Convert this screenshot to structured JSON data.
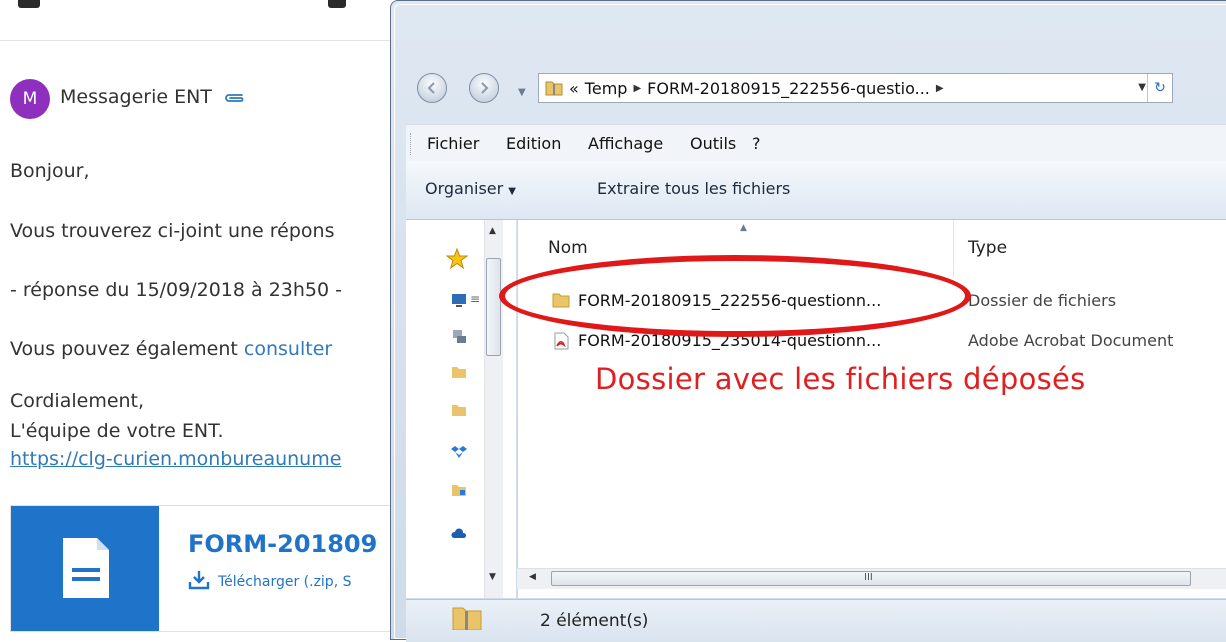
{
  "email": {
    "avatar_letter": "M",
    "sender": "Messagerie ENT",
    "greeting": "Bonjour,",
    "line1": "Vous trouverez ci-joint une répons",
    "line2": "- réponse du 15/09/2018 à 23h50 -",
    "line3_prefix": "Vous pouvez également ",
    "line3_link": "consulter",
    "closing": "Cordialement,",
    "team": "L'équipe de votre ENT.",
    "url": "https://clg-curien.monbureaunume",
    "attachment": {
      "title": "FORM-201809",
      "download": "Télécharger (.zip, S"
    },
    "colors": {
      "avatar": "#8e2fbd",
      "link": "#2f7ab8",
      "card_accent": "#1f73c8"
    }
  },
  "explorer": {
    "address": {
      "history": "«",
      "segments": [
        "Temp",
        "FORM-20180915_222556-questio..."
      ]
    },
    "menu": [
      "Fichier",
      "Edition",
      "Affichage",
      "Outils",
      "?"
    ],
    "toolbar": {
      "organize": "Organiser",
      "extract": "Extraire tous les fichiers"
    },
    "columns": {
      "name": "Nom",
      "type": "Type"
    },
    "files": [
      {
        "name": "FORM-20180915_222556-questionn...",
        "type": "Dossier de fichiers",
        "icon": "folder-icon"
      },
      {
        "name": "FORM-20180915_235014-questionn...",
        "type": "Adobe Acrobat Document",
        "icon": "pdf-icon"
      }
    ],
    "h_scroll_grip": "III",
    "status": "2 élément(s)"
  },
  "annotation": {
    "text": "Dossier avec les fichiers déposés",
    "color": "#e01818"
  }
}
